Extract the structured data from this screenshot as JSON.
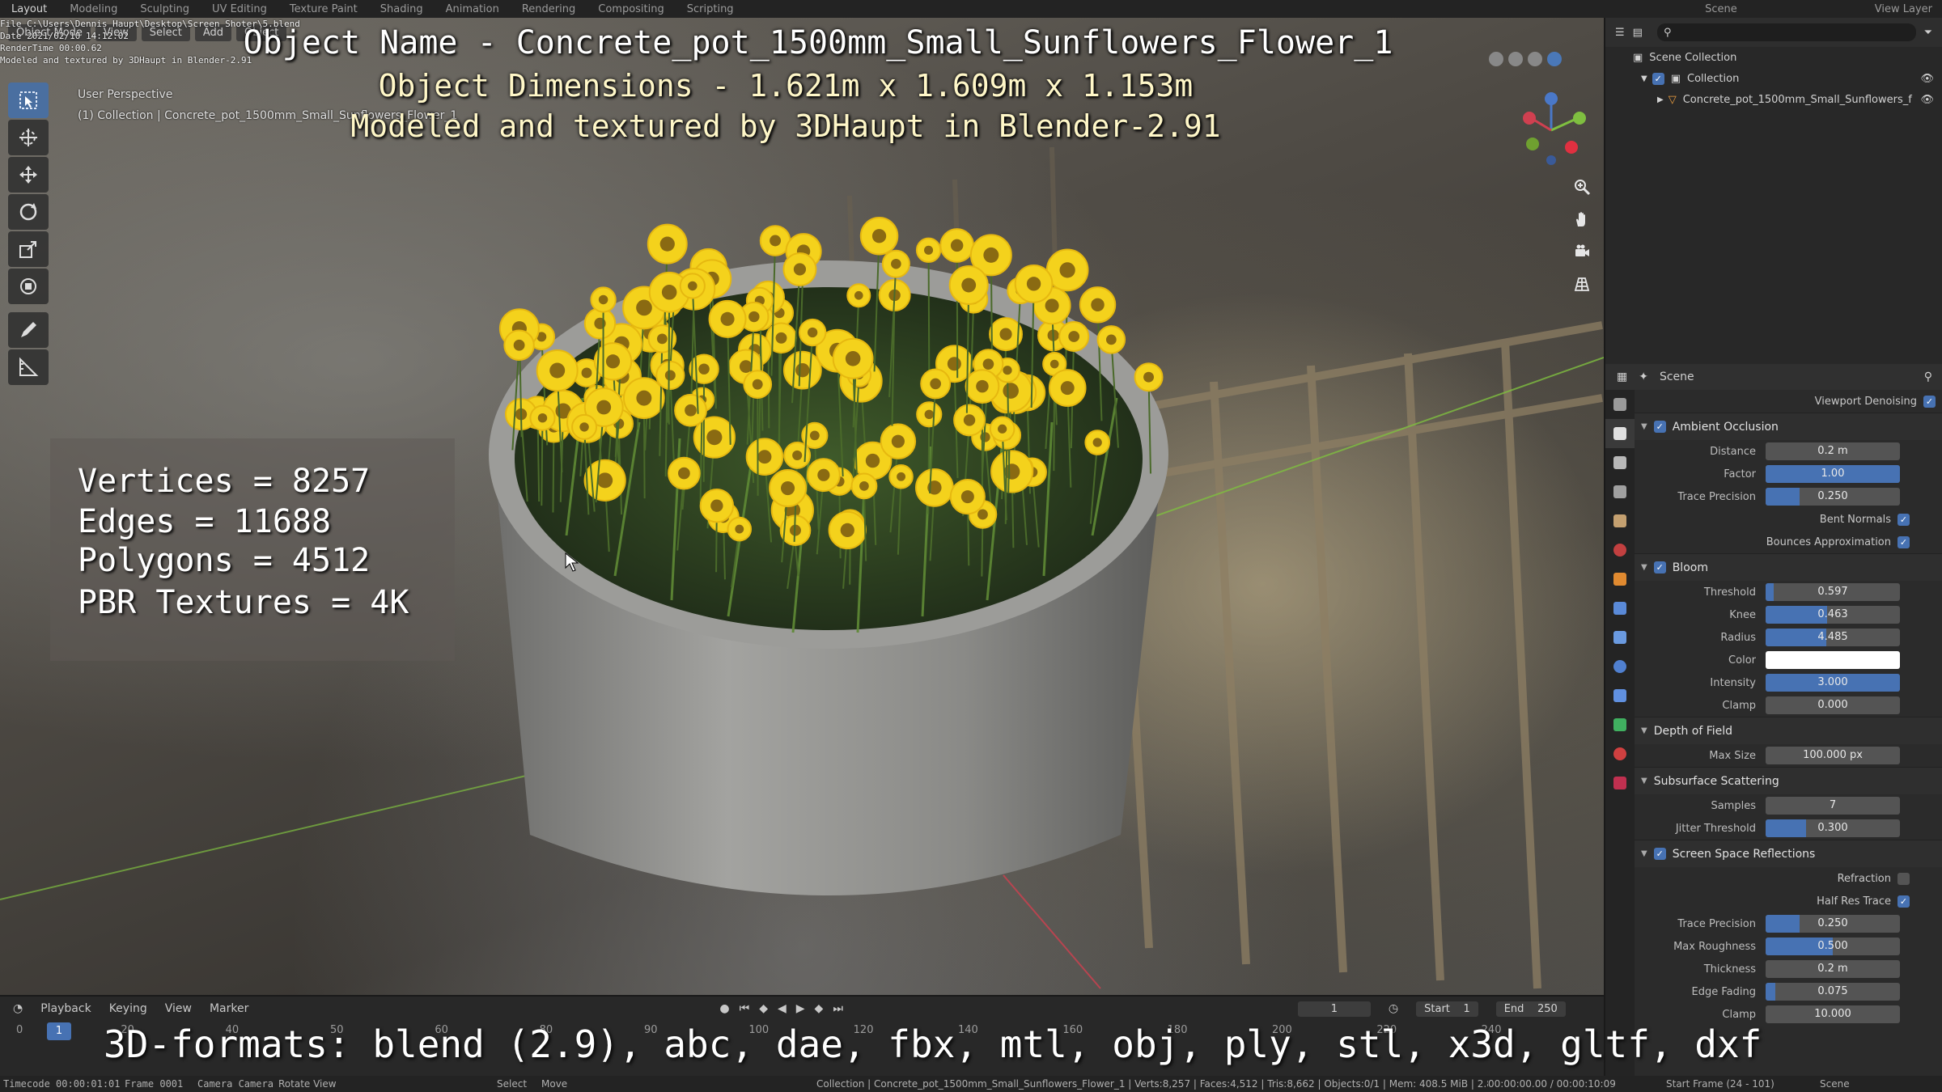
{
  "workspaces": [
    "Layout",
    "Modeling",
    "Sculpting",
    "UV Editing",
    "Texture Paint",
    "Shading",
    "Animation",
    "Rendering",
    "Compositing",
    "Scripting"
  ],
  "topbar": {
    "scene": "Scene",
    "view_layer": "View Layer"
  },
  "meta": {
    "file": "File C:\\Users\\Dennis Haupt\\Desktop\\Screen Shoter\\5.blend",
    "date": "Date 2021/02/10 14:12:02",
    "render_time": "RenderTime 00:00.62",
    "modeled": "Modeled and textured by 3DHaupt in Blender-2.91"
  },
  "viewport": {
    "mode": "Object Mode",
    "menu": [
      "View",
      "Select",
      "Add",
      "Object"
    ],
    "perspective": "User Perspective",
    "collection_line": "(1) Collection | Concrete_pot_1500mm_Small_Sunflowers_Flower_1"
  },
  "overlay": {
    "name": "Object Name - Concrete_pot_1500mm_Small_Sunflowers_Flower_1",
    "dims": "Object Dimensions -  1.621m x 1.609m x 1.153m",
    "credit": "Modeled and textured by 3DHaupt in Blender-2.91",
    "formats": "3D-formats: blend (2.9), abc, dae, fbx, mtl, obj, ply, stl, x3d, gltf, dxf"
  },
  "stats": {
    "vertices": "Vertices = 8257",
    "edges": "Edges = 11688",
    "polygons": "Polygons = 4512",
    "textures": "PBR Textures = 4K"
  },
  "outliner": {
    "scene_collection": "Scene Collection",
    "collection": "Collection",
    "object": "Concrete_pot_1500mm_Small_Sunflowers_f"
  },
  "properties": {
    "header": "Scene",
    "viewport_denoising": "Viewport Denoising",
    "ao": {
      "title": "Ambient Occlusion",
      "distance_label": "Distance",
      "distance": "0.2 m",
      "factor_label": "Factor",
      "factor": "1.00",
      "factor_fill": 1.0,
      "trace_label": "Trace Precision",
      "trace": "0.250",
      "trace_fill": 0.25,
      "bent_normals": "Bent Normals",
      "bounces": "Bounces Approximation"
    },
    "bloom": {
      "title": "Bloom",
      "threshold_label": "Threshold",
      "threshold": "0.597",
      "threshold_fill": 0.06,
      "knee_label": "Knee",
      "knee": "0.463",
      "knee_fill": 0.46,
      "radius_label": "Radius",
      "radius": "4.485",
      "radius_fill": 0.45,
      "color_label": "Color",
      "color": "#ffffff",
      "intensity_label": "Intensity",
      "intensity": "3.000",
      "intensity_fill": 1.0,
      "clamp_label": "Clamp",
      "clamp": "0.000"
    },
    "dof": {
      "title": "Depth of Field",
      "max_size_label": "Max Size",
      "max_size": "100.000 px"
    },
    "sss": {
      "title": "Subsurface Scattering",
      "samples_label": "Samples",
      "samples": "7",
      "jitter_label": "Jitter Threshold",
      "jitter": "0.300",
      "jitter_fill": 0.3
    },
    "ssr": {
      "title": "Screen Space Reflections",
      "refraction": "Refraction",
      "half_res": "Half Res Trace",
      "trace_label": "Trace Precision",
      "trace": "0.250",
      "trace_fill": 0.25,
      "roughness_label": "Max Roughness",
      "roughness": "0.500",
      "roughness_fill": 0.5,
      "thickness_label": "Thickness",
      "thickness": "0.2 m",
      "edge_label": "Edge Fading",
      "edge": "0.075",
      "edge_fill": 0.075,
      "clamp_label": "Clamp",
      "clamp": "10.000"
    }
  },
  "timeline": {
    "menu": [
      "Playback",
      "Keying",
      "View",
      "Marker"
    ],
    "current_frame": "1",
    "start_label": "Start",
    "start": "1",
    "end_label": "End",
    "end": "250",
    "ticks": [
      "0",
      "20",
      "40",
      "50",
      "60",
      "80",
      "90",
      "100",
      "120",
      "140",
      "160",
      "180",
      "200",
      "220",
      "240"
    ]
  },
  "statusbar": {
    "timecode": "Timecode 00:00:01:01",
    "frame": "Frame 0001",
    "camera": "Camera Camera",
    "rotate": "Rotate View",
    "select": "Select",
    "move": "Move",
    "info": "Collection | Concrete_pot_1500mm_Small_Sunflowers_Flower_1 | Verts:8,257 | Faces:4,512 | Tris:8,662 | Objects:0/1 | Mem: 408.5 MiB | 2.83.4",
    "time": "00:00:00.00 / 00:00:10:09",
    "start_frame": "Start Frame (24 - 101)",
    "scene": "Scene"
  },
  "colors": {
    "accent": "#4772b3",
    "flower": "#f4d21c",
    "pot": "#8c8c89"
  }
}
